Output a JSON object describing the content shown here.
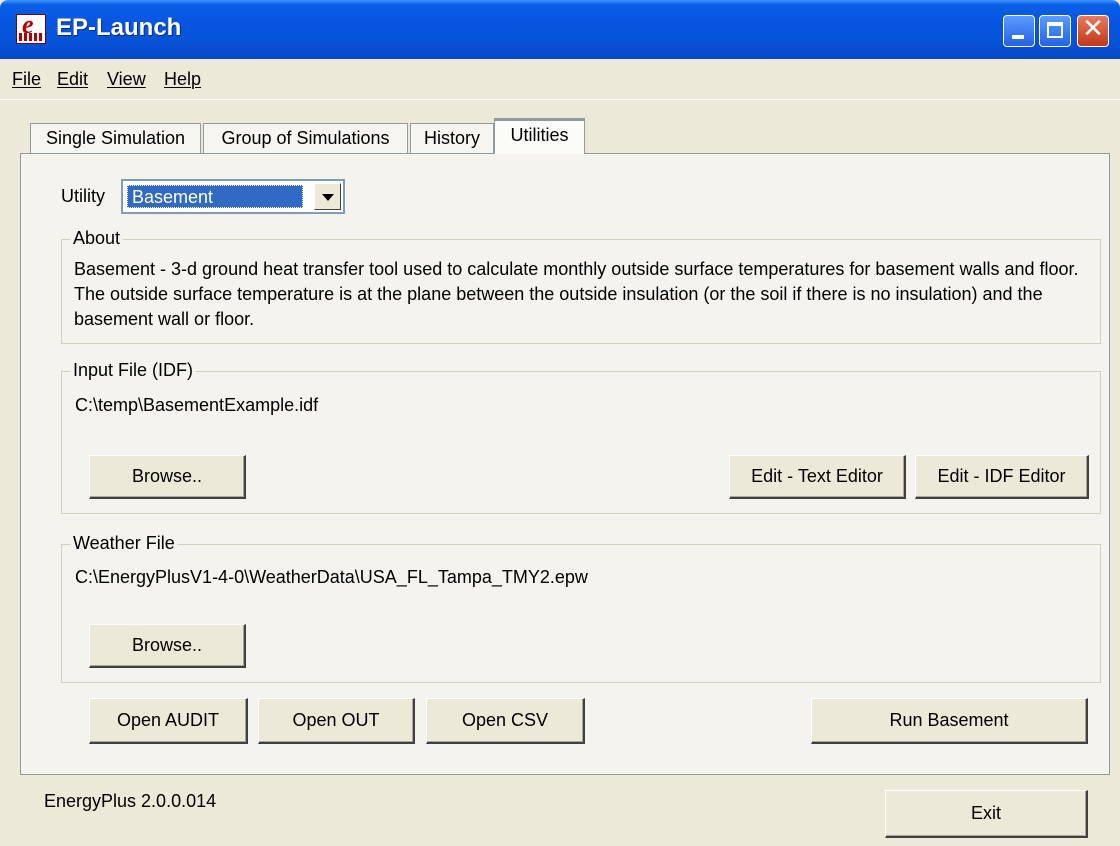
{
  "window": {
    "title": "EP-Launch",
    "icon": "energyplus-logo-icon",
    "controls": [
      "minimize-icon",
      "maximize-icon",
      "close-icon"
    ]
  },
  "menu": {
    "items": [
      {
        "label": "File",
        "accel": "F"
      },
      {
        "label": "Edit",
        "accel": "E"
      },
      {
        "label": "View",
        "accel": "V"
      },
      {
        "label": "Help",
        "accel": "H"
      }
    ]
  },
  "tabs": [
    {
      "label": "Single Simulation"
    },
    {
      "label": "Group of Simulations"
    },
    {
      "label": "History"
    },
    {
      "label": "Utilities",
      "active": true
    }
  ],
  "utility": {
    "label": "Utility",
    "selected": "Basement"
  },
  "about": {
    "title": "About",
    "text": "Basement - 3-d ground heat transfer tool used to calculate monthly outside surface temperatures for basement walls and floor. The outside surface temperature is at the plane between the outside insulation (or the soil if there is no insulation) and the basement wall or floor."
  },
  "input_file": {
    "title": "Input File (IDF)",
    "path": "C:\\temp\\BasementExample.idf",
    "browse_label": "Browse..",
    "edit_text_label": "Edit - Text Editor",
    "edit_idf_label": "Edit - IDF Editor"
  },
  "weather_file": {
    "title": "Weather File",
    "path": "C:\\EnergyPlusV1-4-0\\WeatherData\\USA_FL_Tampa_TMY2.epw",
    "browse_label": "Browse.."
  },
  "actions": {
    "open_audit": "Open AUDIT",
    "open_out": "Open OUT",
    "open_csv": "Open CSV",
    "run": "Run Basement"
  },
  "footer": {
    "version": "EnergyPlus 2.0.0.014",
    "exit_label": "Exit"
  },
  "colors": {
    "titlebar": "#0754e0",
    "selection": "#316ac5",
    "window_bg": "#ece9d8"
  }
}
